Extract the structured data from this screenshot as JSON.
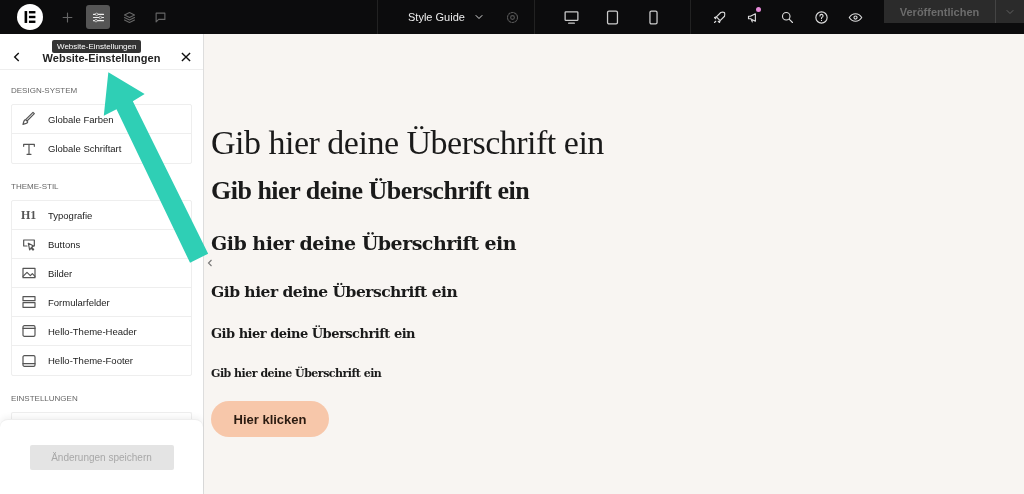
{
  "topbar": {
    "tools": [
      {
        "kind": "logo"
      },
      {
        "kind": "add",
        "selected": false
      },
      {
        "kind": "settings",
        "selected": true
      },
      {
        "kind": "layers",
        "selected": false
      },
      {
        "kind": "comments",
        "selected": false
      }
    ],
    "page_selector": "Style Guide",
    "devices": [
      {
        "kind": "desktop"
      },
      {
        "kind": "tablet"
      },
      {
        "kind": "mobile"
      }
    ],
    "actions": [
      {
        "kind": "rocket",
        "badge": false
      },
      {
        "kind": "megaphone",
        "badge": true
      },
      {
        "kind": "search",
        "badge": false
      },
      {
        "kind": "help",
        "badge": false
      },
      {
        "kind": "eye",
        "badge": false
      }
    ],
    "publish": {
      "label": "Veröffentlichen",
      "disabled": true
    }
  },
  "tooltip": "Website-Einstellungen",
  "sidebar": {
    "title": "Website-Einstellungen",
    "sections": [
      {
        "heading": "DESIGN-SYSTEM",
        "items": [
          {
            "label": "Globale Farben",
            "kind": "brush"
          },
          {
            "label": "Globale Schriftart",
            "kind": "type"
          }
        ]
      },
      {
        "heading": "THEME-STIL",
        "items": [
          {
            "label": "Typografie",
            "kind": "heading",
            "glyph": "H1"
          },
          {
            "label": "Buttons",
            "kind": "pointer"
          },
          {
            "label": "Bilder",
            "kind": "image"
          },
          {
            "label": "Formularfelder",
            "kind": "form"
          },
          {
            "label": "Hello-Theme-Header",
            "kind": "header"
          },
          {
            "label": "Hello-Theme-Footer",
            "kind": "footer"
          }
        ]
      },
      {
        "heading": "EINSTELLUNGEN"
      }
    ],
    "save": {
      "label": "Änderungen speichern",
      "disabled": true
    }
  },
  "canvas": {
    "headings": [
      {
        "kind": "h1",
        "text": "Gib hier deine Überschrift ein"
      },
      {
        "kind": "h2",
        "text": "Gib hier deine Überschrift ein"
      },
      {
        "kind": "h3",
        "text": "Gib hier deine Überschrift ein"
      },
      {
        "kind": "h4",
        "text": "Gib hier deine Überschrift ein"
      },
      {
        "kind": "h5",
        "text": "Gib hier deine Überschrift ein"
      },
      {
        "kind": "h6",
        "text": "Gib hier deine Überschrift ein"
      }
    ],
    "button": "Hier klicken"
  }
}
